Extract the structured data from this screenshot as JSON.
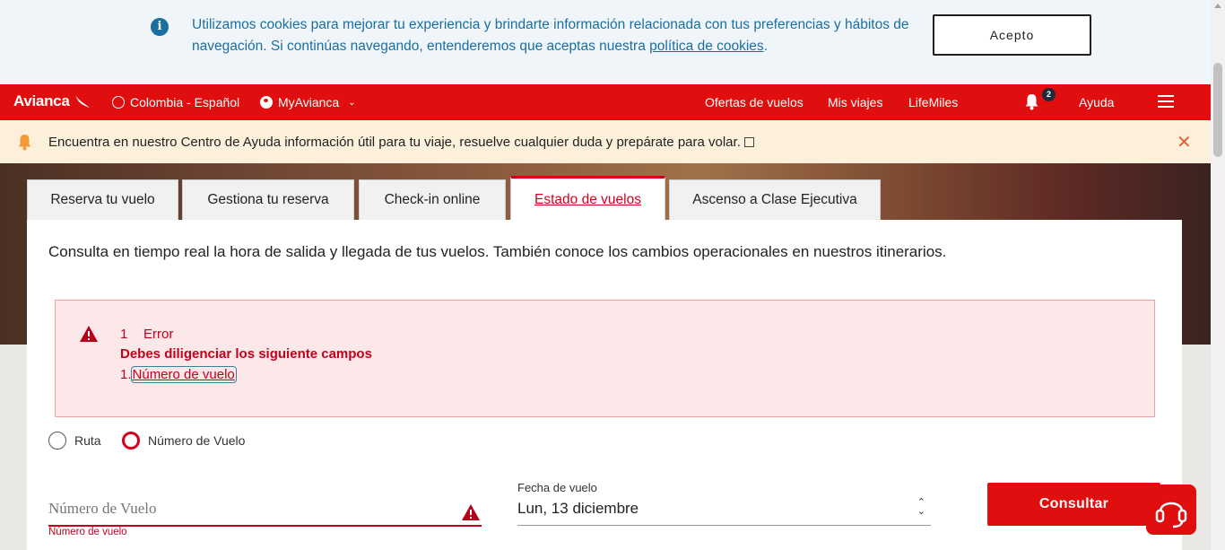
{
  "cookie": {
    "message": "Utilizamos cookies para mejorar tu experiencia y brindarte información relacionada con tus preferencias y hábitos de navegación. Si continúas navegando, entenderemos que aceptas nuestra",
    "link": "política de cookies",
    "suffix": ".",
    "accept": "Acepto"
  },
  "nav": {
    "logo": "Avianca",
    "region": "Colombia - Español",
    "account": "MyAvianca",
    "links": [
      "Ofertas de vuelos",
      "Mis viajes",
      "LifeMiles"
    ],
    "notification_count": "2",
    "help": "Ayuda",
    "brand_color": "#e00e0e"
  },
  "helpbar": {
    "text": "Encuentra en nuestro Centro de Ayuda información útil para tu viaje, resuelve cualquier duda y prepárate para volar."
  },
  "tabs": [
    {
      "label": "Reserva tu vuelo"
    },
    {
      "label": "Gestiona tu reserva"
    },
    {
      "label": "Check-in online"
    },
    {
      "label": "Estado de vuelos",
      "active": true
    },
    {
      "label": "Ascenso a Clase Ejecutiva"
    }
  ],
  "main": {
    "lead": "Consulta en tiempo real la hora de salida y llegada de tus vuelos. También conoce los cambios operacionales en nuestros itinerarios.",
    "error": {
      "count": "1",
      "title": "Error",
      "subtitle": "Debes diligenciar los siguiente campos",
      "item_index": "1.",
      "item_link": "Número de vuelo"
    },
    "radios": [
      {
        "label": "Ruta",
        "selected": false
      },
      {
        "label": "Número de Vuelo",
        "selected": true
      }
    ],
    "flight_number": {
      "placeholder": "Número de Vuelo",
      "value": "",
      "error_text": "Número de vuelo"
    },
    "date": {
      "label": "Fecha de vuelo",
      "value": "Lun, 13 diciembre"
    },
    "submit": "Consultar"
  }
}
